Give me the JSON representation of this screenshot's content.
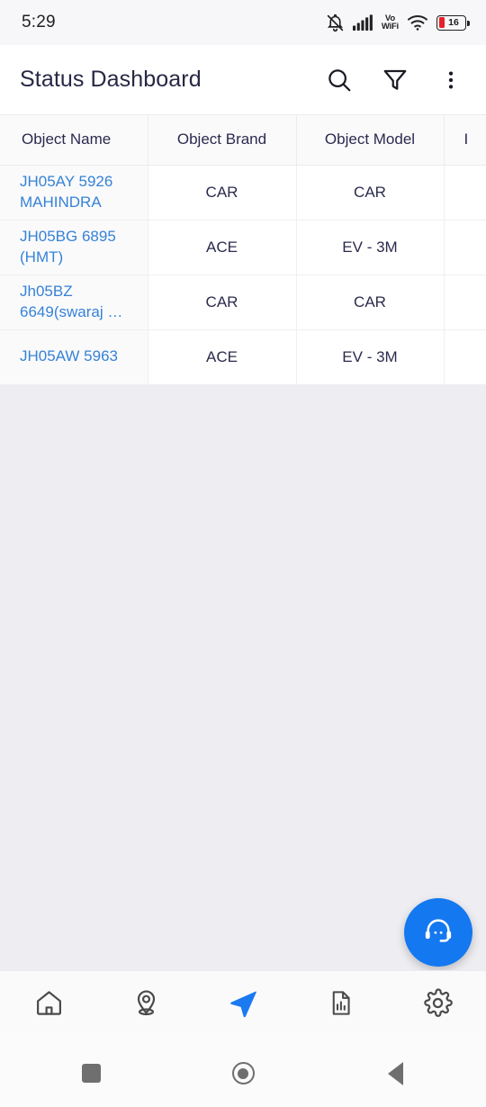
{
  "status_bar": {
    "time": "5:29",
    "icons": [
      "mute-bell-icon",
      "cellular-signal-icon",
      "vowifi-icon",
      "wifi-icon",
      "battery-icon"
    ],
    "vowifi_top": "Vo",
    "vowifi_bottom": "WiFi",
    "battery_level": "16",
    "battery_color": "#e8202a"
  },
  "app_bar": {
    "title": "Status Dashboard",
    "actions": [
      {
        "name": "search-icon",
        "label": "Search"
      },
      {
        "name": "filter-icon",
        "label": "Filter"
      },
      {
        "name": "overflow-menu-icon",
        "label": "More options"
      }
    ]
  },
  "table": {
    "columns": [
      "Object Name",
      "Object Brand",
      "Object Model",
      "I"
    ],
    "rows": [
      {
        "object_name": "JH05AY 5926 MAHINDRA",
        "object_brand": "CAR",
        "object_model": "CAR",
        "extra": ""
      },
      {
        "object_name": "JH05BG 6895 (HMT)",
        "object_brand": "ACE",
        "object_model": "EV - 3M",
        "extra": ""
      },
      {
        "object_name": "Jh05BZ 6649(swaraj …",
        "object_brand": "CAR",
        "object_model": "CAR",
        "extra": ""
      },
      {
        "object_name": "JH05AW 5963",
        "object_brand": "ACE",
        "object_model": "EV - 3M",
        "extra": ""
      }
    ],
    "link_color": "#3682d6"
  },
  "fab": {
    "name": "support-headset-icon",
    "label": "Support",
    "color": "#1478f0"
  },
  "bottom_nav": {
    "items": [
      {
        "name": "nav-home",
        "icon": "home-icon",
        "label": "Home",
        "active": false
      },
      {
        "name": "nav-location",
        "icon": "map-pin-icon",
        "label": "Location",
        "active": false
      },
      {
        "name": "nav-track",
        "icon": "navigation-arrow-icon",
        "label": "Track",
        "active": true
      },
      {
        "name": "nav-reports",
        "icon": "report-chart-icon",
        "label": "Reports",
        "active": false
      },
      {
        "name": "nav-settings",
        "icon": "gear-icon",
        "label": "Settings",
        "active": false
      }
    ],
    "active_color": "#1a7af0",
    "inactive_color": "#4a4a4a"
  },
  "system_nav": {
    "buttons": [
      {
        "name": "recents-button",
        "label": "Recents"
      },
      {
        "name": "home-button",
        "label": "Home"
      },
      {
        "name": "back-button",
        "label": "Back"
      }
    ]
  }
}
